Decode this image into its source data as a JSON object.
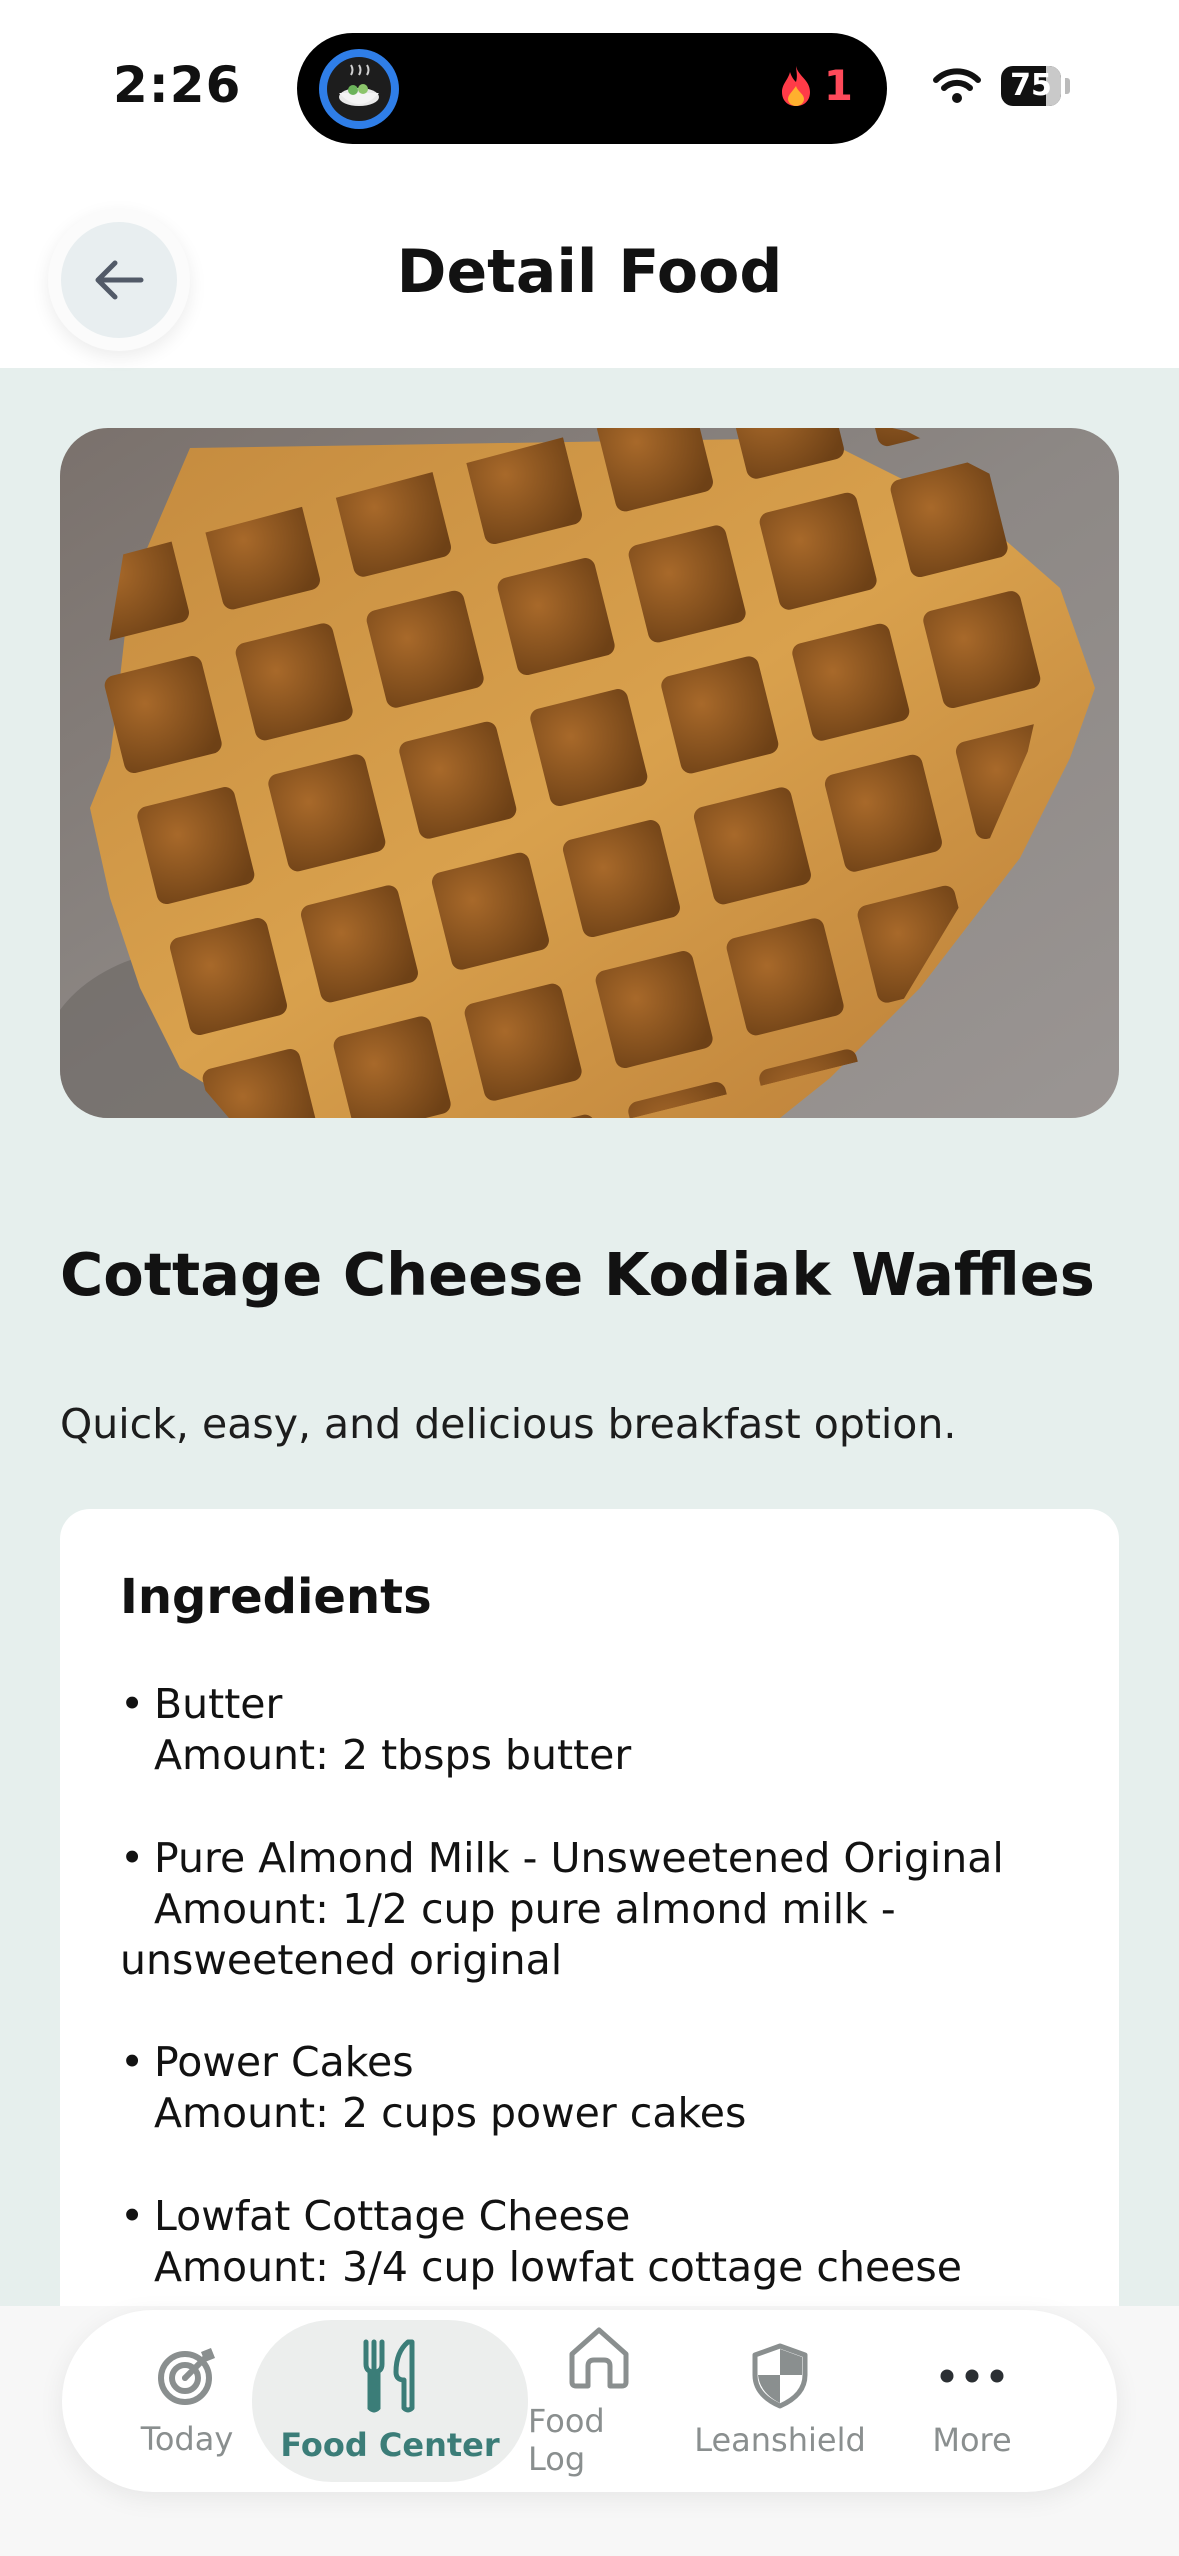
{
  "status_bar": {
    "time": "2:26",
    "streak_count": "1",
    "battery": "75"
  },
  "header": {
    "title": "Detail Food"
  },
  "food": {
    "name": "Cottage Cheese Kodiak Waffles",
    "description": "Quick, easy, and delicious breakfast option."
  },
  "ingredients": {
    "title": "Ingredients",
    "items": [
      {
        "name": "Butter",
        "amount": "Amount: 2 tbsps butter"
      },
      {
        "name": "Pure Almond Milk - Unsweetened Original",
        "amount": "Amount: 1/2 cup pure almond milk - unsweetened original"
      },
      {
        "name": "Power Cakes",
        "amount": "Amount: 2 cups power cakes"
      },
      {
        "name": "Lowfat Cottage Cheese",
        "amount": "Amount: 3/4 cup lowfat cottage cheese"
      }
    ]
  },
  "tabs": [
    {
      "label": "Today",
      "icon": "target-icon"
    },
    {
      "label": "Food Center",
      "icon": "fork-knife-icon",
      "active": true
    },
    {
      "label": "Food Log",
      "icon": "home-icon"
    },
    {
      "label": "Leanshield",
      "icon": "shield-icon"
    },
    {
      "label": "More",
      "icon": "more-icon"
    }
  ],
  "colors": {
    "accent": "#3b7d78",
    "background": "#e6efed",
    "streak": "#ff4a5a"
  }
}
